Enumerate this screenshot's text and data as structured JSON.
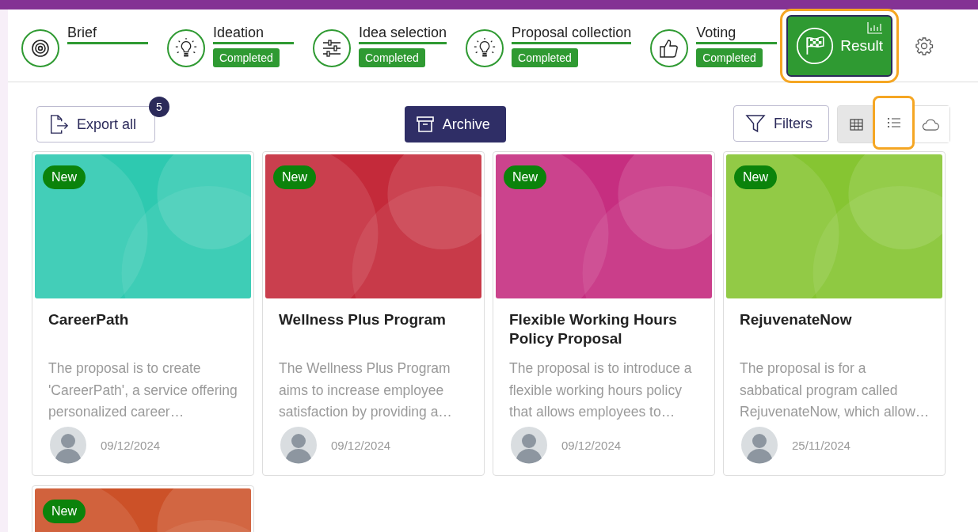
{
  "steps": [
    {
      "kind": "target",
      "label": "Brief",
      "selected": false
    },
    {
      "kind": "bulb",
      "label": "Ideation",
      "status": "Completed",
      "selected": false
    },
    {
      "kind": "sliders",
      "label": "Idea selection",
      "status": "Completed",
      "selected": false
    },
    {
      "kind": "bulb",
      "label": "Proposal collection",
      "status": "Completed",
      "selected": false
    },
    {
      "kind": "thumb",
      "label": "Voting",
      "status": "Completed",
      "selected": false
    },
    {
      "kind": "result",
      "label": "Result",
      "selected": true
    }
  ],
  "toolbar": {
    "export": {
      "label": "Export all",
      "count": "5"
    },
    "archive": {
      "label": "Archive"
    },
    "filters": {
      "label": "Filters"
    },
    "views": [
      {
        "kind": "table",
        "selected": true,
        "highlighted": false
      },
      {
        "kind": "list",
        "selected": false,
        "highlighted": true
      },
      {
        "kind": "cloud",
        "selected": false,
        "highlighted": false
      }
    ]
  },
  "cards": [
    {
      "badge": "New",
      "color": "#2ec9b0",
      "title": "CareerPath",
      "description": "The proposal is to create 'CareerPath', a service offering personalized career…",
      "date": "09/12/2024"
    },
    {
      "badge": "New",
      "color": "#c42a3a",
      "title": "Wellness Plus Program",
      "description": "The Wellness Plus Program aims to increase employee satisfaction by providing a…",
      "date": "09/12/2024"
    },
    {
      "badge": "New",
      "color": "#c62e80",
      "title": "Flexible Working Hours Policy Proposal",
      "description": "The proposal is to introduce a flexible working hours policy that allows employees to…",
      "date": "09/12/2024"
    },
    {
      "badge": "New",
      "color": "#86c532",
      "title": "RejuvenateNow",
      "description": "The proposal is for a sabbatical program called RejuvenateNow, which allow…",
      "date": "25/11/2024"
    },
    {
      "badge": "New",
      "color": "#cc5128"
    }
  ]
}
